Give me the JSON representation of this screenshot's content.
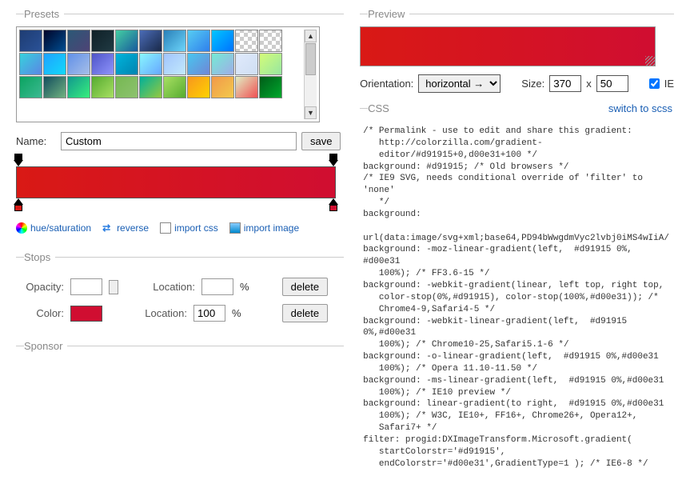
{
  "presets": {
    "legend": "Presets",
    "items": [
      "linear-gradient(135deg,#1e3c72,#2a5298)",
      "linear-gradient(135deg,#000428,#004e92)",
      "linear-gradient(135deg,#2b5876,#4e4376)",
      "linear-gradient(135deg,#0f2027,#203a43)",
      "linear-gradient(135deg,#43cea2,#185a9d)",
      "linear-gradient(135deg,#4b6cb7,#182848)",
      "linear-gradient(135deg,#2980b9,#6dd5fa)",
      "linear-gradient(135deg,#56ccf2,#2f80ed)",
      "linear-gradient(135deg,#00c6ff,#0072ff)",
      "repeating-conic-gradient(#ccc 0 25%, #fff 0 50%) 0/10px 10px",
      "repeating-conic-gradient(#ccc 0 25%, #fff 0 50%) 0/10px 10px",
      "linear-gradient(135deg,#36d1dc,#5b86e5)",
      "linear-gradient(135deg,#1fa2ff,#12d8fa)",
      "linear-gradient(135deg,#6190e8,#a7bfe8)",
      "linear-gradient(135deg,#4e54c8,#8f94fb)",
      "linear-gradient(135deg,#00b4db,#0083b0)",
      "linear-gradient(135deg,#89f7fe,#66a6ff)",
      "linear-gradient(135deg,#a1c4fd,#c2e9fb)",
      "linear-gradient(135deg,#48c6ef,#6f86d6)",
      "linear-gradient(135deg,#74ebd5,#9face6)",
      "linear-gradient(135deg,#e0eafc,#cfdef3)",
      "linear-gradient(135deg,#d4fc79,#96e6a1)",
      "linear-gradient(135deg,#0ba360,#3cba92)",
      "linear-gradient(135deg,#134e5e,#71b280)",
      "linear-gradient(135deg,#11998e,#38ef7d)",
      "linear-gradient(135deg,#56ab2f,#a8e063)",
      "linear-gradient(135deg,#76b852,#8dc26f)",
      "linear-gradient(135deg,#00b09b,#96c93d)",
      "linear-gradient(135deg,#a8e063,#56ab2f)",
      "linear-gradient(135deg,#f7971e,#ffd200)",
      "linear-gradient(135deg,#f2994a,#f2c94c)",
      "linear-gradient(135deg,#e1eec3,#f05053)",
      "linear-gradient(135deg,#005c18,#00a82d)"
    ]
  },
  "name": {
    "label": "Name:",
    "value": "Custom",
    "save": "save"
  },
  "gradient": {
    "from": "#d91915",
    "to": "#d00e31"
  },
  "actions": {
    "hue": "hue/saturation",
    "reverse": "reverse",
    "import_css": "import css",
    "import_image": "import image"
  },
  "stops": {
    "legend": "Stops",
    "opacity_label": "Opacity:",
    "opacity_value": "",
    "opacity_location": "",
    "location_label": "Location:",
    "percent": "%",
    "color_label": "Color:",
    "color_value": "#d00e31",
    "color_location": "100",
    "delete": "delete"
  },
  "sponsor": {
    "legend": "Sponsor"
  },
  "preview": {
    "legend": "Preview",
    "orientation_label": "Orientation:",
    "orientation_value": "horizontal →",
    "size_label": "Size:",
    "width": "370",
    "height": "50",
    "x": "x",
    "ie_label": "IE",
    "ie_checked": true
  },
  "css": {
    "legend": "CSS",
    "switch": "switch to scss",
    "code": "/* Permalink - use to edit and share this gradient:\n   http://colorzilla.com/gradient-\n   editor/#d91915+0,d00e31+100 */\nbackground: #d91915; /* Old browsers */\n/* IE9 SVG, needs conditional override of 'filter' to 'none'\n   */\nbackground:\n   url(data:image/svg+xml;base64,PD94bWwgdmVyc2lvbj0iMS4wIiA/\nbackground: -moz-linear-gradient(left,  #d91915 0%, #d00e31\n   100%); /* FF3.6-15 */\nbackground: -webkit-gradient(linear, left top, right top,\n   color-stop(0%,#d91915), color-stop(100%,#d00e31)); /*\n   Chrome4-9,Safari4-5 */\nbackground: -webkit-linear-gradient(left,  #d91915 0%,#d00e31\n   100%); /* Chrome10-25,Safari5.1-6 */\nbackground: -o-linear-gradient(left,  #d91915 0%,#d00e31\n   100%); /* Opera 11.10-11.50 */\nbackground: -ms-linear-gradient(left,  #d91915 0%,#d00e31\n   100%); /* IE10 preview */\nbackground: linear-gradient(to right,  #d91915 0%,#d00e31\n   100%); /* W3C, IE10+, FF16+, Chrome26+, Opera12+,\n   Safari7+ */\nfilter: progid:DXImageTransform.Microsoft.gradient(\n   startColorstr='#d91915',\n   endColorstr='#d00e31',GradientType=1 ); /* IE6-8 */"
  }
}
